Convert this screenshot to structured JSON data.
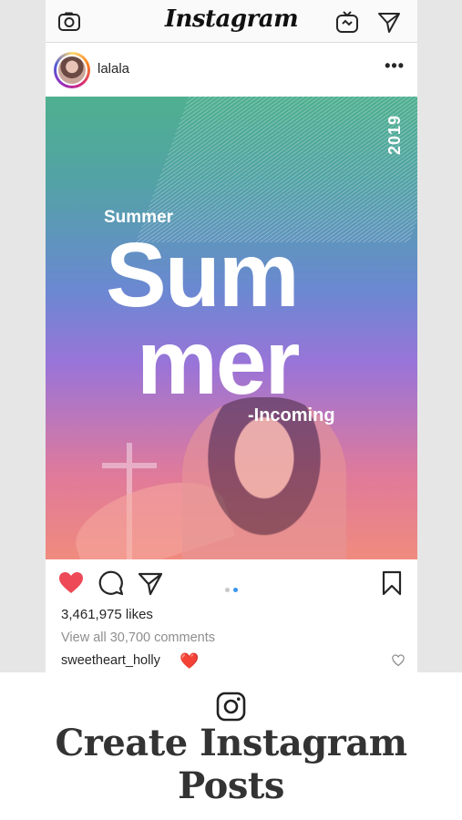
{
  "topbar": {
    "app_title": "Instagram",
    "icons": [
      "camera-icon",
      "igtv-icon",
      "direct-message-icon"
    ]
  },
  "post": {
    "username": "lalala",
    "more_label": "•••",
    "image_text": {
      "year": "2019",
      "small_title": "Summer",
      "big_line1": "Sum",
      "big_line2": "mer",
      "subtitle": "-Incoming"
    },
    "actions": [
      "heart-icon",
      "comment-icon",
      "share-icon",
      "bookmark-icon"
    ],
    "carousel": {
      "count": 2,
      "active_index": 1
    },
    "likes": "3,461,975 likes",
    "view_comments": "View all 30,700 comments",
    "comment": {
      "username": "sweetheart_holly",
      "text": "❤️"
    }
  },
  "banner": {
    "icon": "instagram-logo-icon",
    "caption": "Create Instagram Posts"
  },
  "colors": {
    "heart": "#ed4956",
    "accent_dot": "#3897f0",
    "muted_text": "#8e8e8e"
  }
}
